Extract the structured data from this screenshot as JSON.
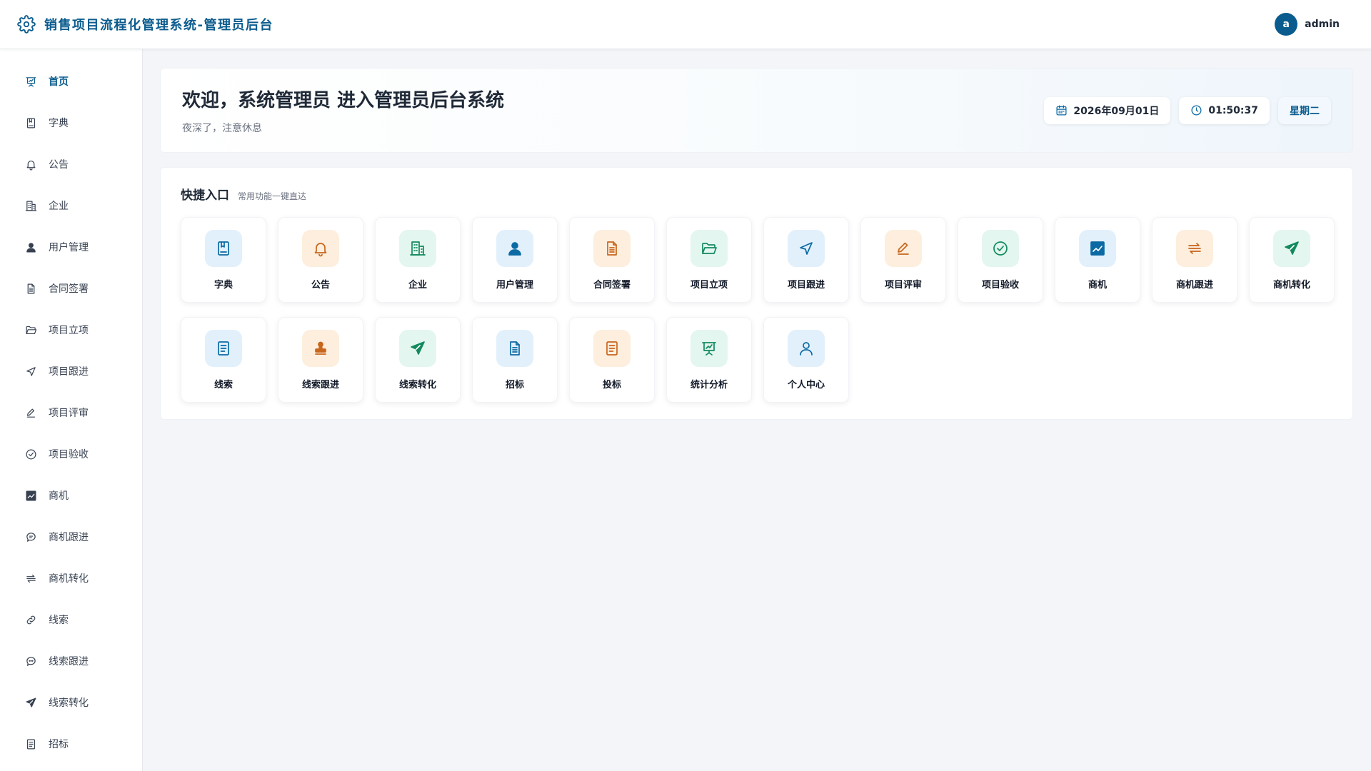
{
  "header": {
    "title": "销售项目流程化管理系统-管理员后台",
    "logo_icon": "gear-icon",
    "avatar_letter": "a",
    "username": "admin"
  },
  "sidebar": {
    "items": [
      {
        "label": "首页",
        "icon": "presentation-chart-icon",
        "active": true
      },
      {
        "label": "字典",
        "icon": "book-icon"
      },
      {
        "label": "公告",
        "icon": "bell-icon"
      },
      {
        "label": "企业",
        "icon": "building-icon"
      },
      {
        "label": "用户管理",
        "icon": "user-icon"
      },
      {
        "label": "合同签署",
        "icon": "document-icon"
      },
      {
        "label": "项目立项",
        "icon": "folder-open-icon"
      },
      {
        "label": "项目跟进",
        "icon": "navigation-icon"
      },
      {
        "label": "项目评审",
        "icon": "pen-icon"
      },
      {
        "label": "项目验收",
        "icon": "check-circle-icon"
      },
      {
        "label": "商机",
        "icon": "chart-square-icon"
      },
      {
        "label": "商机跟进",
        "icon": "chat-icon"
      },
      {
        "label": "商机转化",
        "icon": "arrows-swap-icon"
      },
      {
        "label": "线索",
        "icon": "link-icon"
      },
      {
        "label": "线索跟进",
        "icon": "chat-dots-icon"
      },
      {
        "label": "线索转化",
        "icon": "send-icon"
      },
      {
        "label": "招标",
        "icon": "list-doc-icon"
      }
    ]
  },
  "welcome": {
    "title": "欢迎，系统管理员 进入管理员后台系统",
    "subtitle": "夜深了，注意休息",
    "date": "2026年09月01日",
    "time": "01:50:37",
    "weekday": "星期二"
  },
  "quick": {
    "title": "快捷入口",
    "subtitle": "常用功能一键直达",
    "items": [
      {
        "label": "字典",
        "icon": "book-icon",
        "color": "blue"
      },
      {
        "label": "公告",
        "icon": "bell-icon",
        "color": "orange"
      },
      {
        "label": "企业",
        "icon": "building-icon",
        "color": "green"
      },
      {
        "label": "用户管理",
        "icon": "user-icon",
        "color": "blue"
      },
      {
        "label": "合同签署",
        "icon": "document-icon",
        "color": "orange"
      },
      {
        "label": "项目立项",
        "icon": "folder-open-icon",
        "color": "green"
      },
      {
        "label": "项目跟进",
        "icon": "navigation-icon",
        "color": "blue"
      },
      {
        "label": "项目评审",
        "icon": "pen-icon",
        "color": "orange"
      },
      {
        "label": "项目验收",
        "icon": "check-circle-icon",
        "color": "green"
      },
      {
        "label": "商机",
        "icon": "chart-square-icon",
        "color": "blue"
      },
      {
        "label": "商机跟进",
        "icon": "arrows-swap-icon",
        "color": "orange"
      },
      {
        "label": "商机转化",
        "icon": "send-icon",
        "color": "green"
      },
      {
        "label": "线索",
        "icon": "list-doc-icon",
        "color": "blue"
      },
      {
        "label": "线索跟进",
        "icon": "stamp-icon",
        "color": "orange"
      },
      {
        "label": "线索转化",
        "icon": "send-icon",
        "color": "green"
      },
      {
        "label": "招标",
        "icon": "document-icon",
        "color": "blue"
      },
      {
        "label": "投标",
        "icon": "list-doc-icon",
        "color": "orange"
      },
      {
        "label": "统计分析",
        "icon": "presentation-chart-icon",
        "color": "green"
      },
      {
        "label": "个人中心",
        "icon": "user-outline-icon",
        "color": "blue"
      }
    ]
  },
  "colors": {
    "primary": "#0b5c8e",
    "blue_tint": "#e2f0fb",
    "orange_tint": "#fdeedd",
    "green_tint": "#e3f6ef"
  }
}
